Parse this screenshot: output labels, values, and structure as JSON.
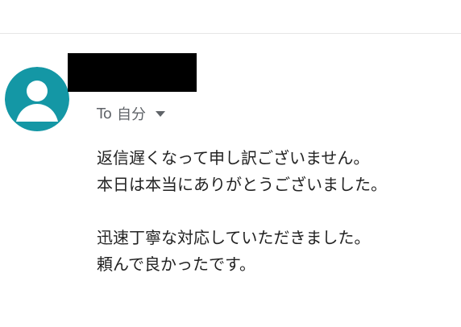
{
  "email": {
    "sender_redacted": "",
    "recipient_prefix": "To",
    "recipient_name": "自分",
    "recipient_dropdown_icon": "caret-down-icon",
    "avatar_icon": "person-icon",
    "body_lines": [
      "返信遅くなって申し訳ございません。",
      "本日は本当にありがとうございました。",
      "",
      "迅速丁寧な対応していただきました。",
      "頼んで良かったです。"
    ]
  },
  "colors": {
    "avatar_bg": "#1497a5",
    "avatar_fg": "#ffffff",
    "muted_text": "#5f6368",
    "body_text": "#222222",
    "redaction": "#000000"
  }
}
